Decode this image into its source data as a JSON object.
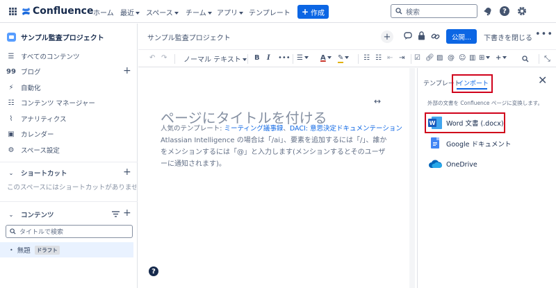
{
  "topnav": {
    "app_name": "Confluence",
    "items": [
      {
        "label": "ホーム",
        "caret": false
      },
      {
        "label": "最近",
        "caret": true
      },
      {
        "label": "スペース",
        "caret": true
      },
      {
        "label": "チーム",
        "caret": true
      },
      {
        "label": "アプリ",
        "caret": true
      },
      {
        "label": "テンプレート",
        "caret": false
      }
    ],
    "create_label": "作成",
    "search_placeholder": "検索"
  },
  "sidebar": {
    "space_name": "サンプル監査プロジェクト",
    "items": [
      {
        "label": "すべてのコンテンツ",
        "icon": "list-icon"
      },
      {
        "label": "ブログ",
        "icon": "quote-icon"
      },
      {
        "label": "自動化",
        "icon": "lightning-icon"
      },
      {
        "label": "コンテンツ マネージャー",
        "icon": "content-manager-icon"
      },
      {
        "label": "アナリティクス",
        "icon": "graph-icon"
      },
      {
        "label": "カレンダー",
        "icon": "calendar-icon"
      },
      {
        "label": "スペース設定",
        "icon": "gear-icon"
      }
    ],
    "shortcuts_header": "ショートカット",
    "shortcuts_empty": "このスペースにはショートカットがありません",
    "content_header": "コンテンツ",
    "filter_placeholder": "タイトルで検索",
    "tree_item": {
      "title": "無題",
      "badge": "ドラフト"
    }
  },
  "editor_header": {
    "breadcrumb": "サンプル監査プロジェクト",
    "publish_label": "公開...",
    "close_draft_label": "下書きを閉じる"
  },
  "toolbar": {
    "text_style": "ノーマル テキスト"
  },
  "editor": {
    "title_placeholder": "ページにタイトルを付ける",
    "popular_prefix": "人気のテンプレート: ",
    "template_1": "ミーティング議事録",
    "separator": "、",
    "template_2": "DACI: 意思決定ドキュメンテーション",
    "hint_line_1": "Atlassian Intelligence の場合は「/ai」、要素を追加するには「/」、誰か",
    "hint_line_2": "をメンションするには「@」と入力します(メンションするとそのユーザ",
    "hint_line_3": "ーに通知されます)。"
  },
  "right_panel": {
    "tabs": [
      {
        "label": "テンプレート",
        "active": false
      },
      {
        "label": "インポート",
        "active": true
      }
    ],
    "description": "外部の文書を Confluence ページに変換します。",
    "import_options": [
      {
        "label": "Word 文書 (.docx)",
        "icon": "word-icon"
      },
      {
        "label": "Google ドキュメント",
        "icon": "google-docs-icon"
      },
      {
        "label": "OneDrive",
        "icon": "onedrive-icon"
      }
    ]
  },
  "colors": {
    "brand": "#0c66e4",
    "highlight": "#d0021b",
    "word": "#185abd",
    "google_docs": "#4285f4",
    "onedrive": "#0364b8"
  }
}
